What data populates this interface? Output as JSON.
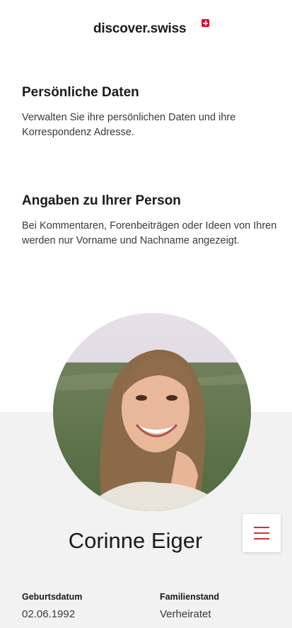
{
  "header": {
    "logo_text": "discover.swiss",
    "logo_icon": "swiss-cross-icon",
    "brand_color": "#e4002b"
  },
  "personal": {
    "title": "Persönliche Daten",
    "description": "Verwalten Sie ihre persönlichen Daten und ihre Korrespondenz Adresse."
  },
  "person_info": {
    "title": "Angaben zu Ihrer Person",
    "description": "Bei Kommentaren, Forenbeiträgen oder Ideen von Ihren werden nur Vorname und Nachname angezeigt."
  },
  "profile": {
    "name": "Corinne Eiger",
    "avatar": "profile-photo"
  },
  "menu": {
    "icon": "hamburger-menu-icon",
    "accent_color": "#d32f3a"
  },
  "details": [
    {
      "label": "Geburtsdatum",
      "value": "02.06.1992"
    },
    {
      "label": "Familienstand",
      "value": "Verheiratet"
    }
  ]
}
